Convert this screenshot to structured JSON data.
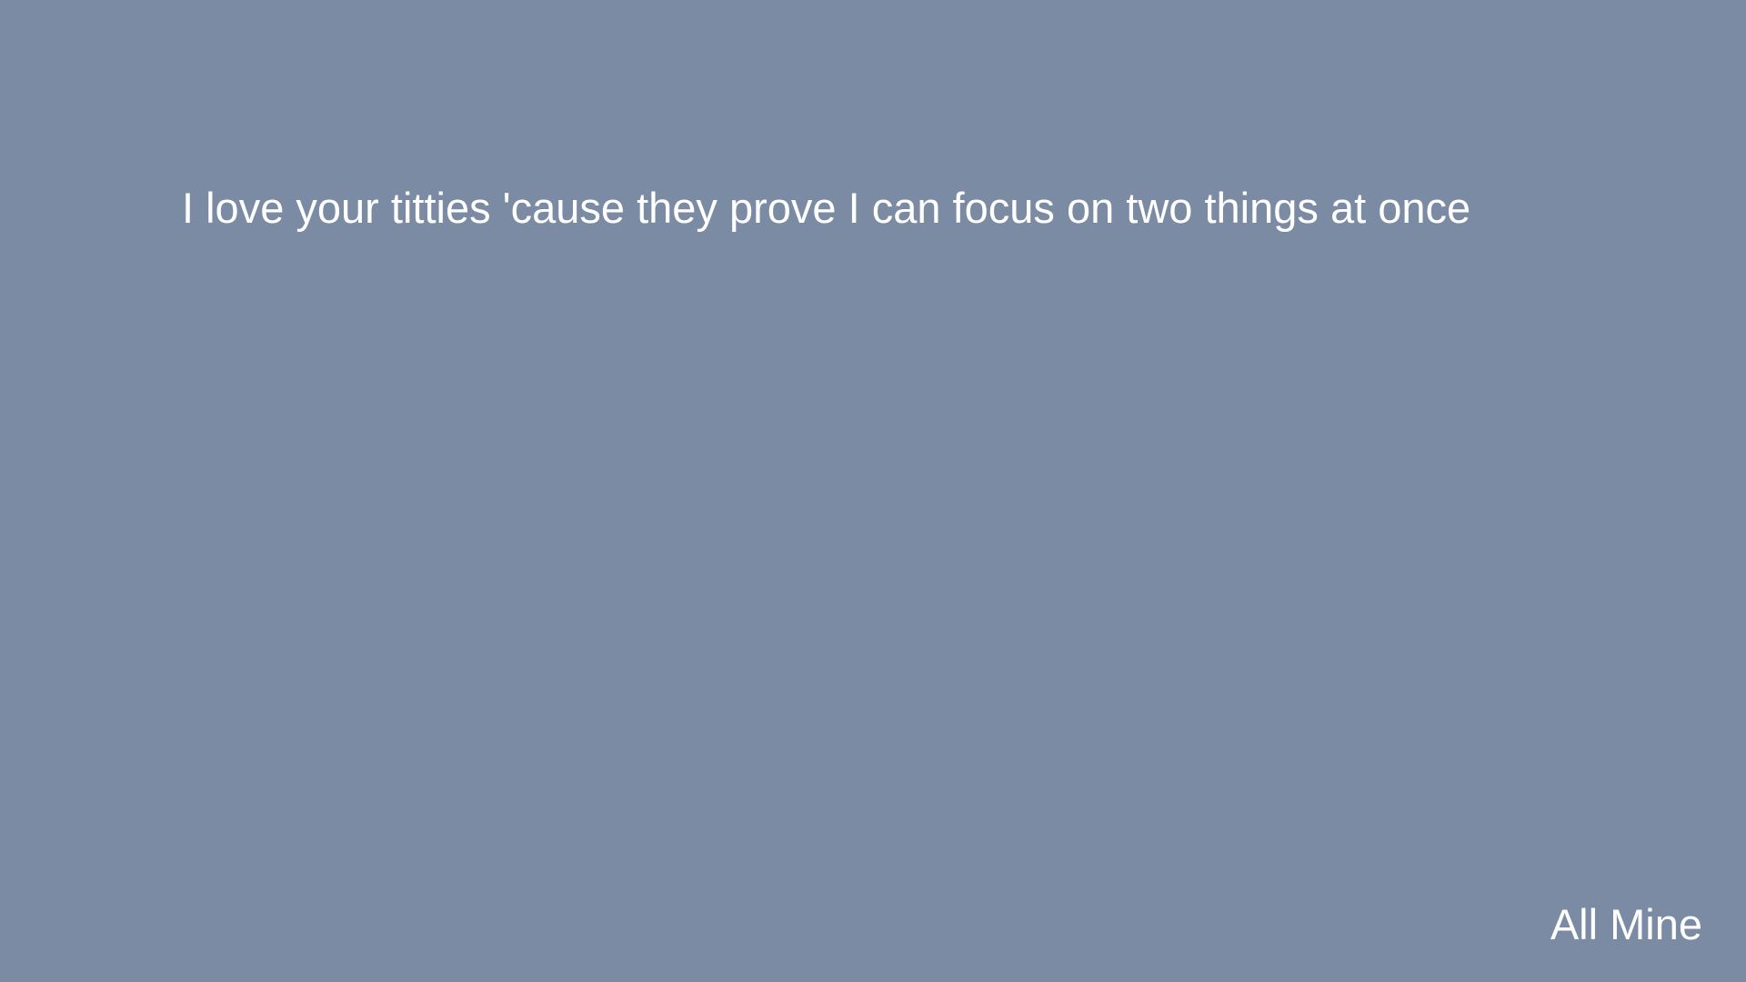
{
  "colors": {
    "background": "#7a8ba3",
    "text": "#ffffff"
  },
  "main": {
    "text": "I love your titties 'cause they prove I can focus on two things at once"
  },
  "footer": {
    "label": "All Mine"
  }
}
